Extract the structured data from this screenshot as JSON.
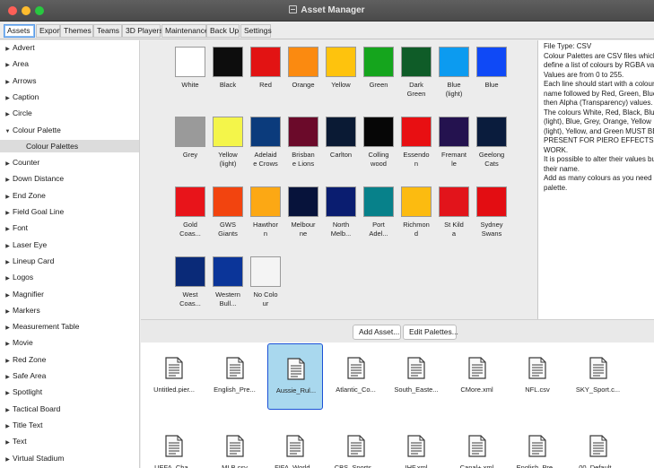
{
  "window": {
    "title": "Asset Manager"
  },
  "tabs": [
    {
      "label": "Assets",
      "active": true
    },
    {
      "label": "Export"
    },
    {
      "label": "Themes"
    },
    {
      "label": "Teams"
    },
    {
      "label": "3D Players"
    },
    {
      "label": "Maintenance"
    },
    {
      "label": "Back Up"
    },
    {
      "label": "Settings"
    }
  ],
  "sidebar": {
    "items": [
      {
        "label": "Advert",
        "expanded": false
      },
      {
        "label": "Area",
        "expanded": false
      },
      {
        "label": "Arrows",
        "expanded": false
      },
      {
        "label": "Caption",
        "expanded": false
      },
      {
        "label": "Circle",
        "expanded": false
      },
      {
        "label": "Colour Palette",
        "expanded": true
      },
      {
        "label": "Colour Palettes",
        "child": true,
        "selected": true
      },
      {
        "label": "Counter",
        "expanded": false
      },
      {
        "label": "Down Distance",
        "expanded": false
      },
      {
        "label": "End Zone",
        "expanded": false
      },
      {
        "label": "Field Goal Line",
        "expanded": false
      },
      {
        "label": "Font",
        "expanded": false
      },
      {
        "label": "Laser Eye",
        "expanded": false
      },
      {
        "label": "Lineup Card",
        "expanded": false
      },
      {
        "label": "Logos",
        "expanded": false
      },
      {
        "label": "Magnifier",
        "expanded": false
      },
      {
        "label": "Markers",
        "expanded": false
      },
      {
        "label": "Measurement Table",
        "expanded": false
      },
      {
        "label": "Movie",
        "expanded": false
      },
      {
        "label": "Red Zone",
        "expanded": false
      },
      {
        "label": "Safe Area",
        "expanded": false
      },
      {
        "label": "Spotlight",
        "expanded": false
      },
      {
        "label": "Tactical Board",
        "expanded": false
      },
      {
        "label": "Title Text",
        "expanded": false
      },
      {
        "label": "Text",
        "expanded": false
      },
      {
        "label": "Virtual Stadium",
        "expanded": false
      }
    ]
  },
  "palette": {
    "swatches": [
      {
        "label": "White",
        "color": "#ffffff"
      },
      {
        "label": "Black",
        "color": "#0d0d0d"
      },
      {
        "label": "Red",
        "color": "#e21313"
      },
      {
        "label": "Orange",
        "color": "#fb8a10"
      },
      {
        "label": "Yellow",
        "color": "#fec30d"
      },
      {
        "label": "Green",
        "color": "#15a51d"
      },
      {
        "label": "Dark\nGreen",
        "color": "#0f5c28"
      },
      {
        "label": "Blue\n(light)",
        "color": "#0c9bf0"
      },
      {
        "label": "Blue",
        "color": "#0f49f6"
      },
      {
        "label": "Grey",
        "color": "#9a9a9a"
      },
      {
        "label": "Yellow\n(light)",
        "color": "#f4f54a"
      },
      {
        "label": "Adelaid\ne Crows",
        "color": "#0b3b7c"
      },
      {
        "label": "Brisban\ne Lions",
        "color": "#6b0a2a"
      },
      {
        "label": "Carlton",
        "color": "#0a1a34"
      },
      {
        "label": "Colling\nwood",
        "color": "#060606"
      },
      {
        "label": "Essendo\nn",
        "color": "#e80f12"
      },
      {
        "label": "Fremant\nle",
        "color": "#24124f"
      },
      {
        "label": "Geelong\nCats",
        "color": "#0a1c3d"
      },
      {
        "label": "Gold\nCoas...",
        "color": "#e8141a"
      },
      {
        "label": "GWS\nGiants",
        "color": "#f2440f"
      },
      {
        "label": "Hawthor\nn",
        "color": "#fca814"
      },
      {
        "label": "Melbour\nne",
        "color": "#07133b"
      },
      {
        "label": "North\nMelb...",
        "color": "#0a1d70"
      },
      {
        "label": "Port\nAdel...",
        "color": "#07818a"
      },
      {
        "label": "Richmon\nd",
        "color": "#fcbb10"
      },
      {
        "label": "St Kild\na",
        "color": "#e2141b"
      },
      {
        "label": "Sydney\nSwans",
        "color": "#e30d12"
      },
      {
        "label": "West\nCoas...",
        "color": "#0a2a78"
      },
      {
        "label": "Western\nBull...",
        "color": "#0b3599"
      },
      {
        "label": "No Colo\nur",
        "color": "#f4f4f4"
      }
    ]
  },
  "info": {
    "lines": [
      "File Type: CSV",
      "Colour Palettes are CSV files which",
      "define a list of colours by RGBA values.",
      "Values are from 0 to 255.",
      "Each line should start with a colour",
      "name followed by Red, Green, Blue,",
      "then Alpha (Transparency) values.",
      "The colours White, Red, Black, Blue",
      "(light), Blue, Grey, Orange, Yellow",
      "(light), Yellow, and Green MUST BE",
      "PRESENT FOR PIERO EFFECTS TO",
      "WORK.",
      "It is possible to alter their values but not",
      "their name.",
      "Add as many colours as you need per",
      "palette."
    ]
  },
  "toolbar": {
    "add_asset": "Add Asset...",
    "edit_palettes": "Edit Palettes..."
  },
  "files": [
    {
      "name": "Untitled.pier..."
    },
    {
      "name": "English_Pre..."
    },
    {
      "name": "Aussie_Rul...",
      "selected": true
    },
    {
      "name": "Atlantic_Co..."
    },
    {
      "name": "South_Easte..."
    },
    {
      "name": "CMore.xml"
    },
    {
      "name": "NFL.csv"
    },
    {
      "name": "SKY_Sport.c..."
    },
    {
      "name": "UEFA_Cha..."
    },
    {
      "name": "MLB.csv"
    },
    {
      "name": "FIFA_World..."
    },
    {
      "name": "CBS_Sports..."
    },
    {
      "name": "IHF.xml"
    },
    {
      "name": "Canal+.xml"
    },
    {
      "name": "English_Pre..."
    },
    {
      "name": "00_Default..."
    }
  ]
}
